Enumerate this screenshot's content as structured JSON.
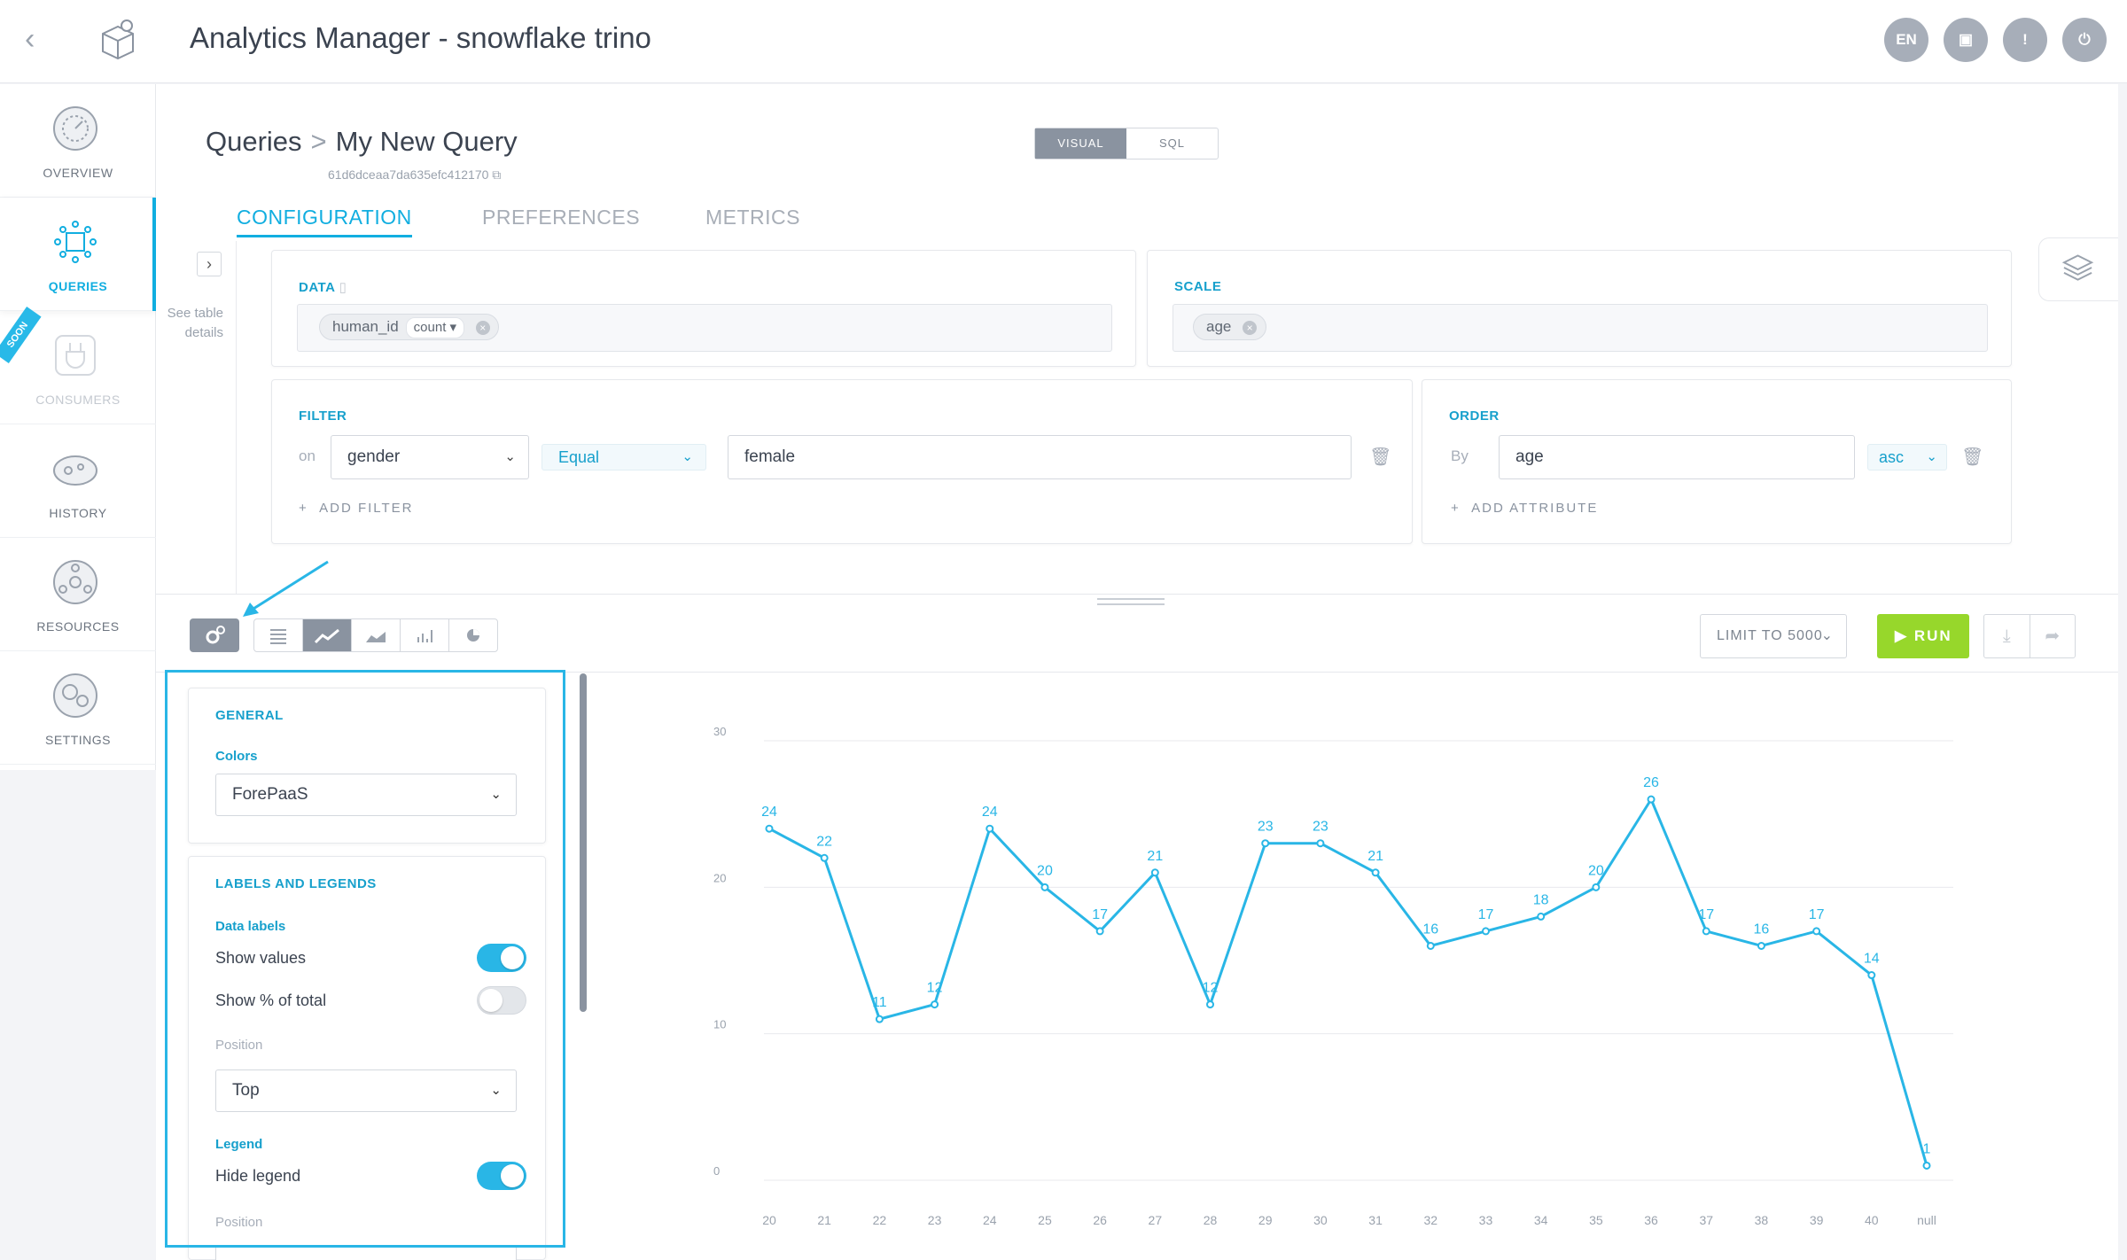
{
  "header": {
    "title": "Analytics Manager - snowflake trino",
    "lang": "EN"
  },
  "sidebar": {
    "items": [
      {
        "label": "OVERVIEW",
        "icon": "overview-dial-icon"
      },
      {
        "label": "QUERIES",
        "icon": "queries-grid-icon"
      },
      {
        "label": "CONSUMERS",
        "icon": "consumers-plug-icon"
      },
      {
        "label": "HISTORY",
        "icon": "history-icon"
      },
      {
        "label": "RESOURCES",
        "icon": "resources-icon"
      },
      {
        "label": "SETTINGS",
        "icon": "settings-gear-icon"
      }
    ],
    "soon_badge": "SOON"
  },
  "page": {
    "breadcrumb_root": "Queries",
    "breadcrumb_current": "My New Query",
    "query_id": "61d6dceaa7da635efc412170",
    "mode_visual": "VISUAL",
    "mode_sql": "SQL",
    "tabs": [
      "CONFIGURATION",
      "PREFERENCES",
      "METRICS"
    ],
    "table_details": "See table details"
  },
  "config": {
    "data_title": "DATA",
    "data_field": "human_id",
    "data_agg": "count",
    "scale_title": "SCALE",
    "scale_field": "age",
    "filter_title": "FILTER",
    "filter_on": "on",
    "filter_attribute": "gender",
    "filter_operator": "Equal",
    "filter_value": "female",
    "add_filter": "ADD FILTER",
    "order_title": "ORDER",
    "order_by": "By",
    "order_attribute": "age",
    "order_direction": "asc",
    "add_attribute": "ADD ATTRIBUTE"
  },
  "toolbar": {
    "limit": "LIMIT TO 5000",
    "run": "RUN"
  },
  "settings_panel": {
    "general_title": "GENERAL",
    "colors_label": "Colors",
    "colors_value": "ForePaaS",
    "labels_title": "LABELS AND LEGENDS",
    "data_labels": "Data labels",
    "show_values": "Show values",
    "show_values_on": true,
    "show_pct": "Show % of total",
    "show_pct_on": false,
    "position_label": "Position",
    "position_value": "Top",
    "legend_label": "Legend",
    "hide_legend": "Hide legend",
    "hide_legend_on": true,
    "legend_position_label": "Position"
  },
  "colors": {
    "accent": "#11aee0",
    "run": "#97d72b",
    "line": "#29b6e6"
  },
  "chart_data": {
    "type": "line",
    "x": [
      "20",
      "21",
      "22",
      "23",
      "24",
      "25",
      "26",
      "27",
      "28",
      "29",
      "30",
      "31",
      "32",
      "33",
      "34",
      "35",
      "36",
      "37",
      "38",
      "39",
      "40",
      "null"
    ],
    "series": [
      {
        "values": [
          24,
          22,
          11,
          12,
          24,
          20,
          17,
          21,
          12,
          23,
          23,
          21,
          16,
          17,
          18,
          20,
          26,
          17,
          16,
          17,
          14,
          1
        ]
      }
    ],
    "ylim": [
      0,
      30
    ],
    "yticks": [
      0,
      10,
      20,
      30
    ],
    "grid": true,
    "data_labels": true,
    "legend": false
  }
}
